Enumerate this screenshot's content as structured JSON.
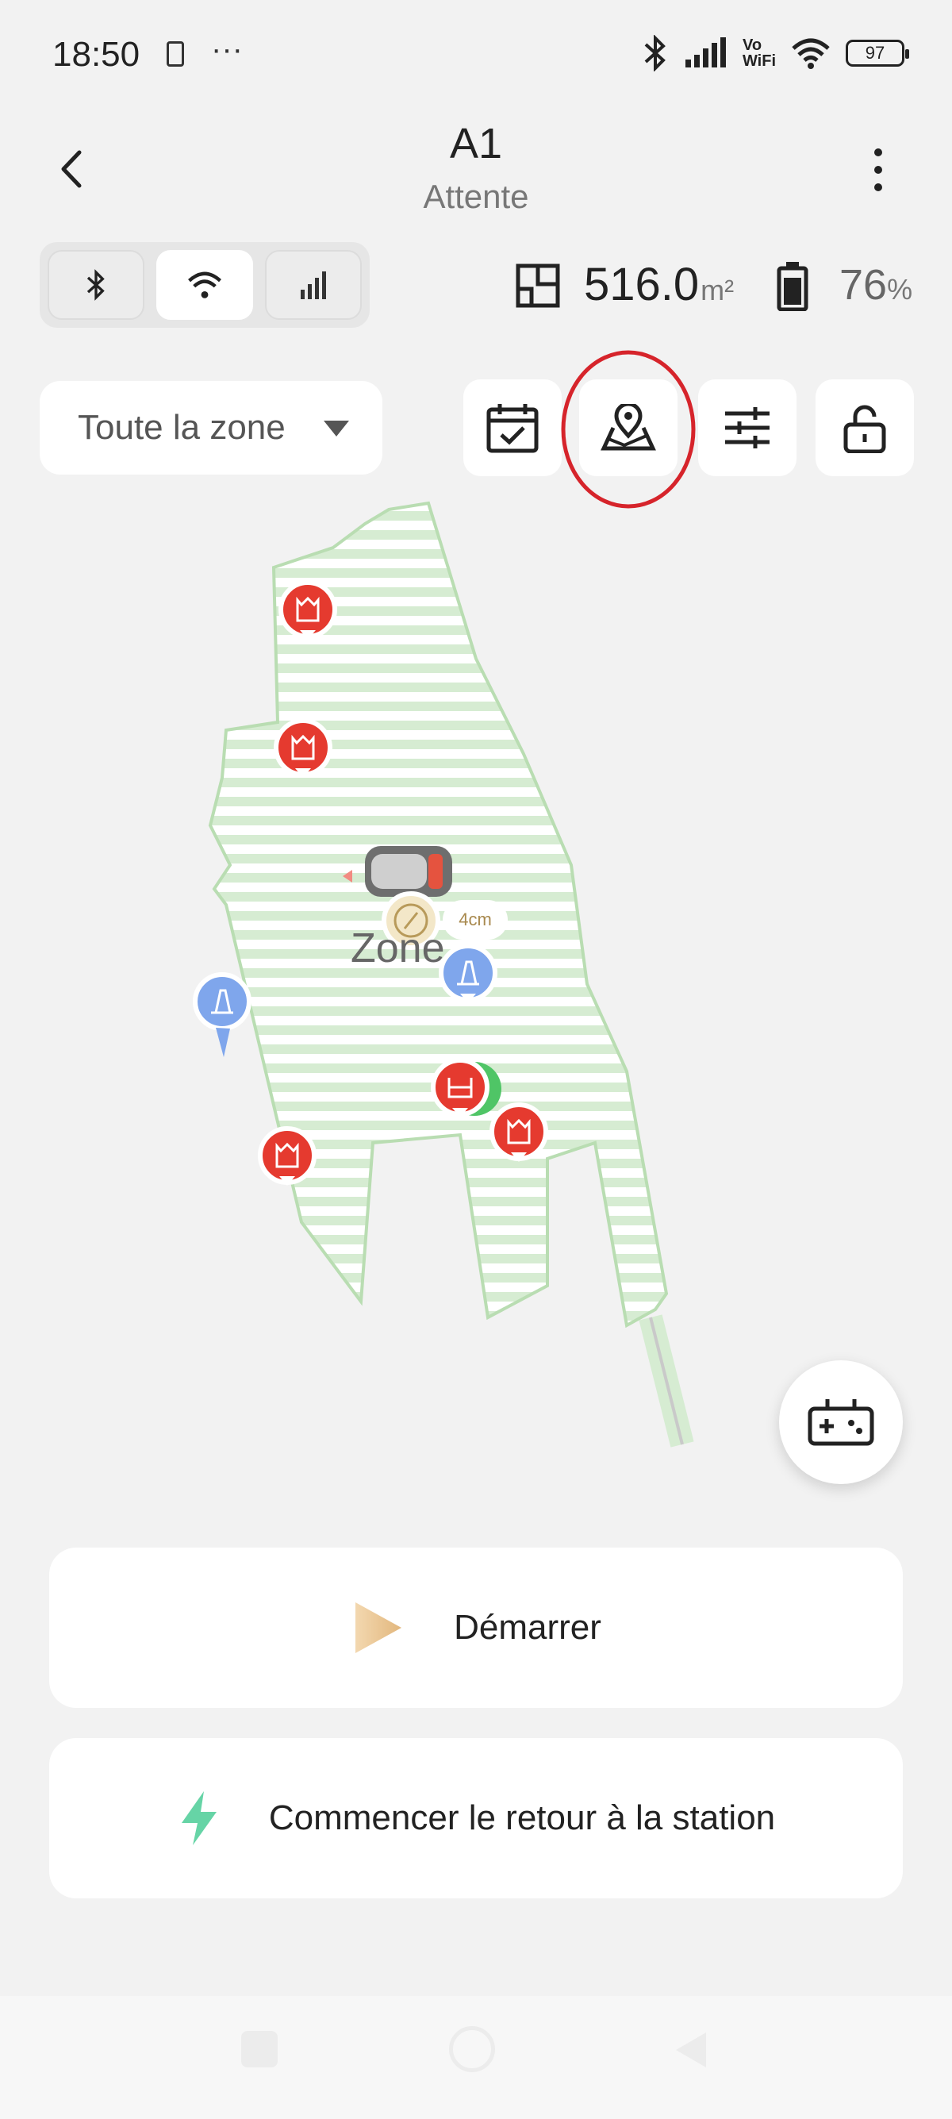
{
  "status_bar": {
    "time": "18:50",
    "dots": "···",
    "battery_level": "97",
    "network_label_top": "Vo",
    "network_label_bottom": "WiFi"
  },
  "header": {
    "title": "A1",
    "subtitle": "Attente"
  },
  "connection": {
    "icons": [
      "bluetooth-icon",
      "wifi-icon",
      "cellular-icon"
    ],
    "active": "wifi"
  },
  "stats": {
    "area_value": "516.0",
    "area_unit": "m²",
    "battery_value": "76",
    "battery_unit": "%"
  },
  "zone_selector": {
    "selected": "Toute la zone"
  },
  "map": {
    "zone_name": "Zone",
    "distance_label": "4cm"
  },
  "actions": {
    "start_label": "Démarrer",
    "return_label": "Commencer le retour à la station"
  },
  "colors": {
    "lawn_stripe": "#d6ecd2",
    "marker_red": "#e53a2f",
    "marker_blue": "#7fa6ec",
    "highlight_circle": "#d6242b",
    "start_gradient": "#e8c79a",
    "return_icon": "#66d4a6"
  }
}
